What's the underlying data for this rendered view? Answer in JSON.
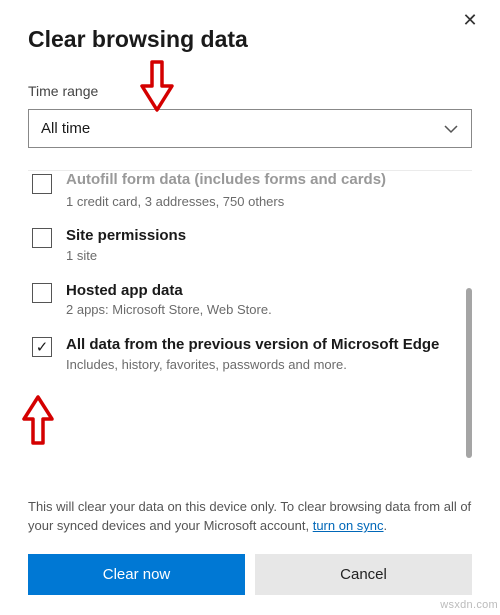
{
  "dialog": {
    "title": "Clear browsing data",
    "close_glyph": "✕",
    "time_range_label": "Time range",
    "time_range_value": "All time"
  },
  "items": [
    {
      "title": "Autofill form data (includes forms and cards)",
      "desc": "1 credit card, 3 addresses, 750 others",
      "checked": false,
      "cut": true
    },
    {
      "title": "Site permissions",
      "desc": "1 site",
      "checked": false,
      "cut": false
    },
    {
      "title": "Hosted app data",
      "desc": "2 apps: Microsoft Store, Web Store.",
      "checked": false,
      "cut": false
    },
    {
      "title": "All data from the previous version of Microsoft Edge",
      "desc": "Includes, history, favorites, passwords and more.",
      "checked": true,
      "cut": false
    }
  ],
  "note": {
    "text_before": "This will clear your data on this device only. To clear browsing data from all of your synced devices and your Microsoft account, ",
    "link_text": "turn on sync",
    "text_after": "."
  },
  "buttons": {
    "primary": "Clear now",
    "secondary": "Cancel"
  },
  "annotations": {
    "arrow_color": "#d40000"
  },
  "watermark": "wsxdn.com",
  "check_glyph": "✓"
}
